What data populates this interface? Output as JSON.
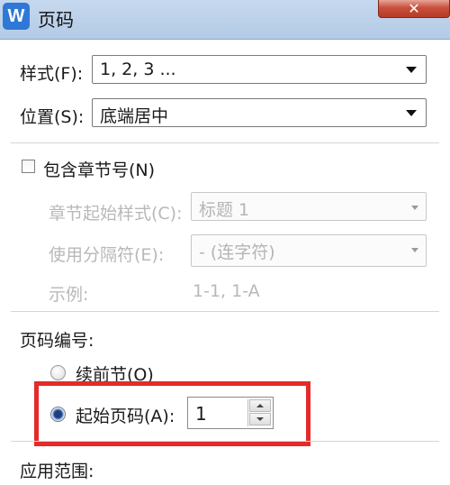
{
  "window": {
    "title": "页码",
    "app_icon_letter": "W",
    "close_symbol": "✕"
  },
  "style_row": {
    "label": "样式(F):",
    "value": "1, 2, 3 ..."
  },
  "position_row": {
    "label": "位置(S):",
    "value": "底端居中"
  },
  "chapter": {
    "checkbox_label": "包含章节号(N)",
    "checked": false,
    "start_style_label": "章节起始样式(C):",
    "start_style_value": "标题 1",
    "separator_label": "使用分隔符(E):",
    "separator_value": "-  (连字符)",
    "example_label": "示例:",
    "example_value": "1-1, 1-A"
  },
  "numbering": {
    "heading": "页码编号:",
    "continue_label": "续前节(O)",
    "continue_selected": false,
    "start_label": "起始页码(A):",
    "start_selected": true,
    "start_value": "1"
  },
  "apply": {
    "heading": "应用范围:"
  },
  "colors": {
    "highlight": "#e52a2a",
    "titlebar": "#c6d8ee",
    "close_button": "#c8503c",
    "disabled_text": "#b8b8b8"
  },
  "icons": {
    "app": "wps-writer-icon",
    "close": "close-icon",
    "dropdown": "chevron-down-icon",
    "spinner_up": "arrow-up-icon",
    "spinner_down": "arrow-down-icon"
  }
}
